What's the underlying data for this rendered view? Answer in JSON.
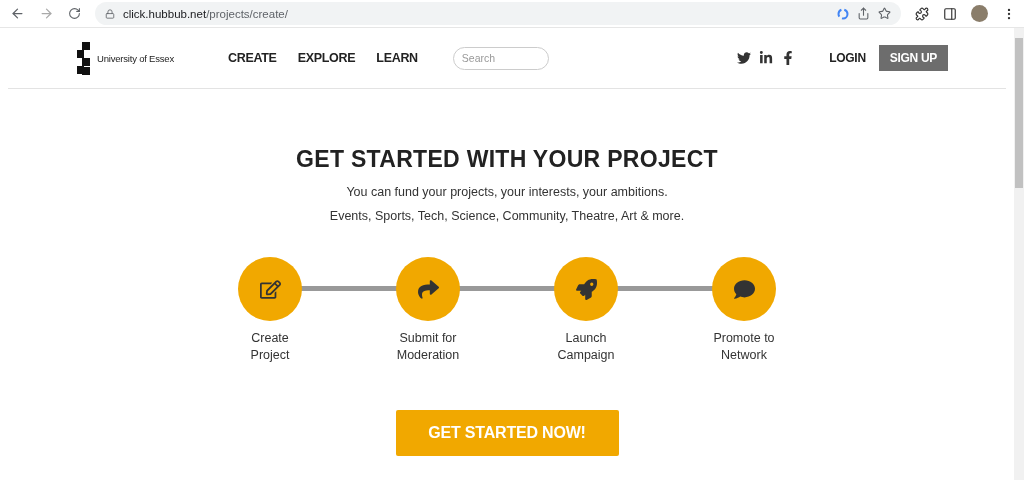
{
  "browser": {
    "url_host": "click.hubbub.net",
    "url_path": "/projects/create/"
  },
  "header": {
    "logo_text": "University of Essex",
    "nav": [
      {
        "label": "CREATE"
      },
      {
        "label": "EXPLORE"
      },
      {
        "label": "LEARN"
      }
    ],
    "search": {
      "placeholder": "Search"
    },
    "login": "LOGIN",
    "signup": "SIGN UP"
  },
  "main": {
    "title": "GET STARTED WITH YOUR PROJECT",
    "lines": [
      "You can fund your projects, your interests, your ambitions.",
      "Events, Sports, Tech, Science, Community, Theatre, Art & more."
    ],
    "steps": [
      {
        "kind": "create",
        "label": [
          "Create",
          "Project"
        ]
      },
      {
        "kind": "submit",
        "label": [
          "Submit for",
          "Moderation"
        ]
      },
      {
        "kind": "launch",
        "label": [
          "Launch",
          "Campaign"
        ]
      },
      {
        "kind": "promote",
        "label": [
          "Promote to",
          "Network"
        ]
      }
    ],
    "cta": "GET STARTED NOW!"
  }
}
